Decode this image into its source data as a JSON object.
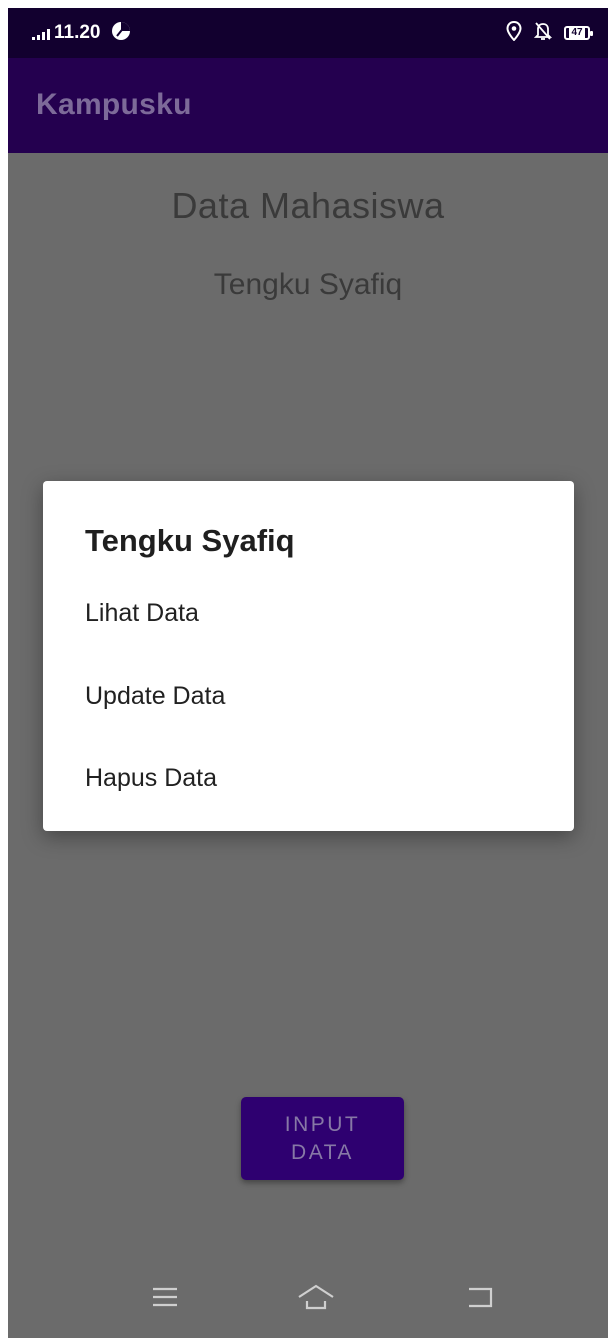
{
  "status_bar": {
    "time": "11.20",
    "battery": "47",
    "icons": [
      "signal-icon",
      "app-notification-icon",
      "location-icon",
      "mute-icon",
      "battery-icon"
    ]
  },
  "app_bar": {
    "title": "Kampusku"
  },
  "main": {
    "title": "Data Mahasiswa",
    "subtitle": "Tengku Syafiq",
    "input_button_label": "INPUT DATA"
  },
  "dialog": {
    "title": "Tengku Syafiq",
    "items": [
      {
        "label": "Lihat Data"
      },
      {
        "label": "Update Data"
      },
      {
        "label": "Hapus Data"
      }
    ]
  },
  "nav_bar": {
    "icons": [
      "menu-icon",
      "home-icon",
      "back-icon"
    ]
  },
  "colors": {
    "status_bar": "#12002f",
    "app_bar": "#24004f",
    "scrim_background": "#6b6b6b",
    "button": "#2e0070",
    "dialog": "#ffffff"
  }
}
